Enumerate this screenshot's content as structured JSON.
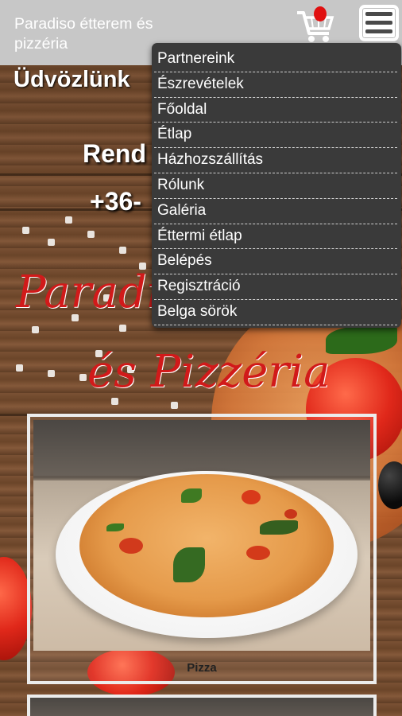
{
  "header": {
    "site_title": "Paradiso étterem és pizzéria",
    "cart_icon": "shopping-cart-icon",
    "menu_icon": "hamburger-menu-icon"
  },
  "hero": {
    "welcome": "Üdvözlünk",
    "order": "Rend",
    "phone": "+36-",
    "script_line1": "Paradi",
    "script_line2": "és Pizzéria"
  },
  "menu": {
    "items": [
      "Partnereink",
      "Észrevételek",
      "Főoldal",
      "Étlap",
      "Házhozszállítás",
      "Rólunk",
      "Galéria",
      "Éttermi étlap",
      "Belépés",
      "Regisztráció",
      "Belga sörök"
    ]
  },
  "products": [
    {
      "caption": "Pizza"
    }
  ],
  "colors": {
    "header_bg": "#c7c7c7",
    "menu_bg": "#3a3a3a",
    "cart_badge": "#e01010",
    "script_red": "#d11a1a"
  }
}
